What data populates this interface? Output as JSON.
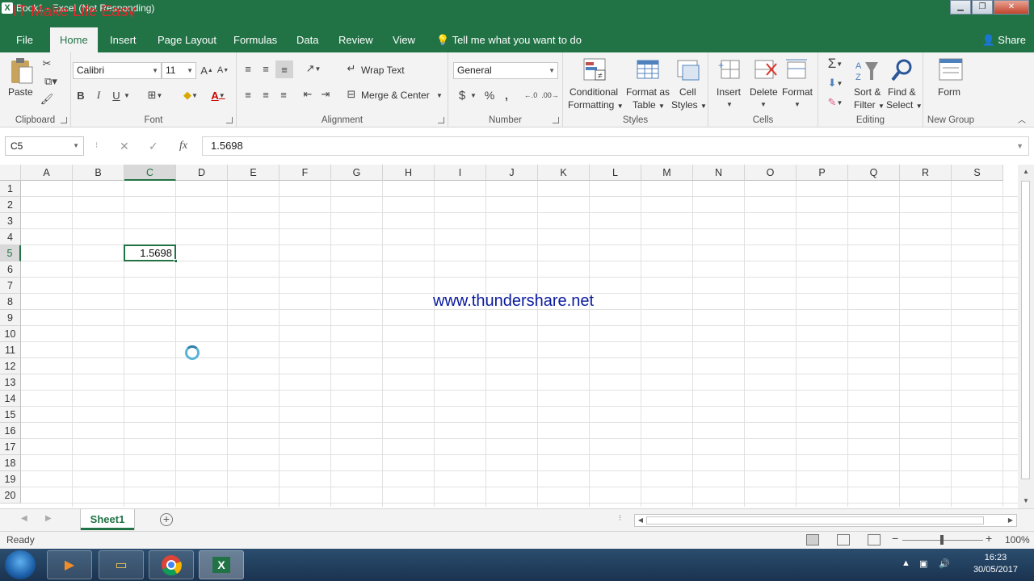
{
  "window": {
    "title": "Book1 - Excel (Not Responding)",
    "watermark": "IT Make Life Easy",
    "app_icon": "excel-icon"
  },
  "tabs": [
    "File",
    "Home",
    "Insert",
    "Page Layout",
    "Formulas",
    "Data",
    "Review",
    "View"
  ],
  "active_tab": "Home",
  "tell_me": "Tell me what you want to do",
  "share": "Share",
  "ribbon": {
    "clipboard": {
      "paste": "Paste",
      "label": "Clipboard"
    },
    "font": {
      "name": "Calibri",
      "size": "11",
      "bold": "B",
      "italic": "I",
      "underline": "U",
      "label": "Font"
    },
    "alignment": {
      "wrap": "Wrap Text",
      "merge": "Merge & Center",
      "label": "Alignment"
    },
    "number": {
      "format": "General",
      "currency": "$",
      "percent": "%",
      "comma": ",",
      "label": "Number"
    },
    "styles": {
      "conditional_1": "Conditional",
      "conditional_2": "Formatting",
      "table_1": "Format as",
      "table_2": "Table",
      "cell_1": "Cell",
      "cell_2": "Styles",
      "label": "Styles"
    },
    "cells": {
      "insert": "Insert",
      "delete": "Delete",
      "format": "Format",
      "label": "Cells"
    },
    "editing": {
      "sort_1": "Sort &",
      "sort_2": "Filter",
      "find_1": "Find &",
      "find_2": "Select",
      "label": "Editing"
    },
    "newgroup": {
      "form": "Form",
      "label": "New Group"
    }
  },
  "formula_bar": {
    "name_box": "C5",
    "formula": "1.5698",
    "fx": "fx"
  },
  "columns": [
    "A",
    "B",
    "C",
    "D",
    "E",
    "F",
    "G",
    "H",
    "I",
    "J",
    "K",
    "L",
    "M",
    "N",
    "O",
    "P",
    "Q",
    "R",
    "S"
  ],
  "rows": [
    "1",
    "2",
    "3",
    "4",
    "5",
    "6",
    "7",
    "8",
    "9",
    "10",
    "11",
    "12",
    "13",
    "14",
    "15",
    "16",
    "17",
    "18",
    "19",
    "20"
  ],
  "selected_cell": {
    "column": "C",
    "row": "5",
    "value": "1.5698"
  },
  "sheet_overlay_text": "www.thundershare.net",
  "sheet_tabs": [
    "Sheet1"
  ],
  "status": {
    "text": "Ready",
    "zoom": "100%"
  },
  "taskbar": {
    "apps": [
      "media-player-icon",
      "file-explorer-icon",
      "chrome-icon",
      "excel-icon"
    ],
    "time": "16:23",
    "date": "30/05/2017"
  },
  "colors": {
    "excel_green": "#217346",
    "ribbon_bg": "#f3f3f3",
    "link_blue": "#0a1a9e"
  }
}
